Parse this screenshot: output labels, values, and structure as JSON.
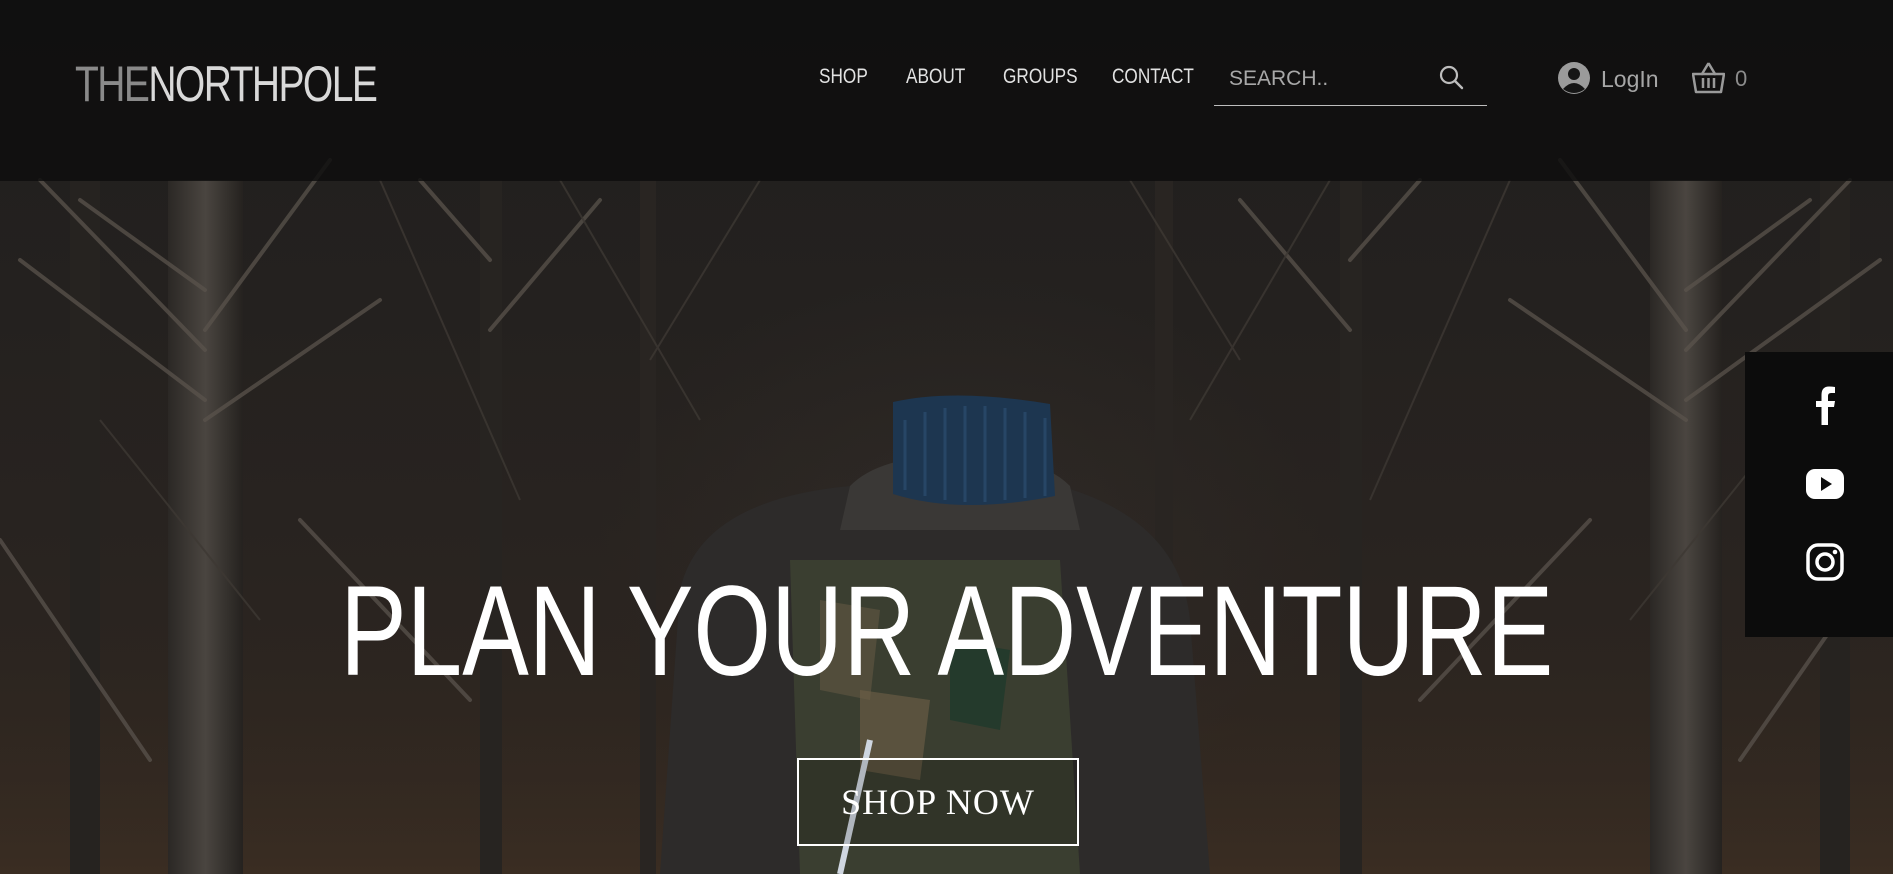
{
  "header": {
    "logo_prefix": "THE",
    "logo_suffix": "NORTHPOLE",
    "nav": [
      {
        "label": "SHOP"
      },
      {
        "label": "ABOUT"
      },
      {
        "label": "GROUPS"
      },
      {
        "label": "CONTACT"
      }
    ],
    "search": {
      "placeholder": "SEARCH..",
      "value": ""
    },
    "login_label": "LogIn",
    "cart_count": "0"
  },
  "hero": {
    "headline": "PLAN YOUR ADVENTURE",
    "cta_label": "SHOP NOW"
  },
  "social": {
    "icons": [
      "facebook-icon",
      "youtube-icon",
      "instagram-icon"
    ]
  },
  "colors": {
    "header_bg": "#0e0e0e",
    "text": "#ffffff",
    "social_bg": "#0c0c0c"
  }
}
